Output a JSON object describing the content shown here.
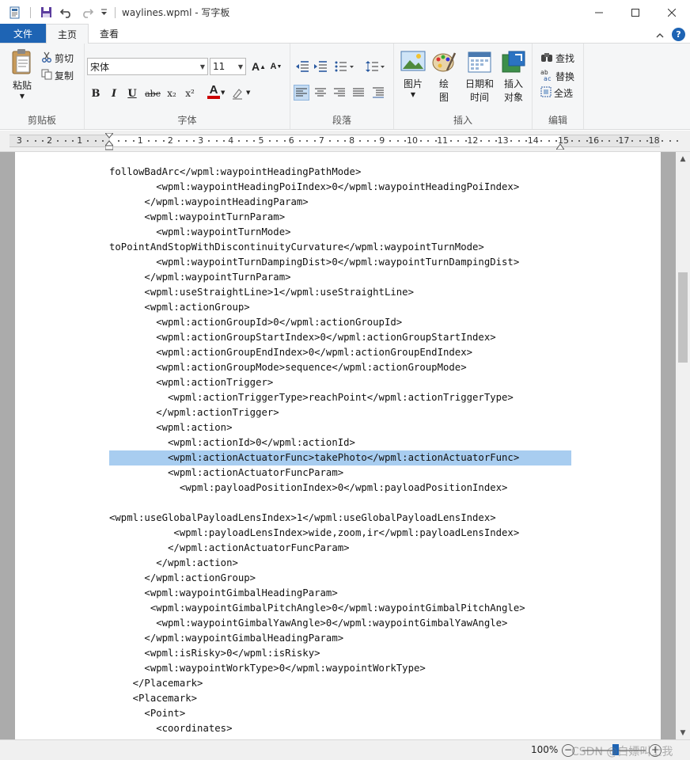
{
  "window": {
    "title": "waylines.wpml - 写字板",
    "title_separator": "|"
  },
  "ribbon_tabs": {
    "file": "文件",
    "home": "主页",
    "view": "查看"
  },
  "clipboard": {
    "paste": "粘贴",
    "cut": "剪切",
    "copy": "复制",
    "group_label": "剪贴板"
  },
  "font": {
    "family": "宋体",
    "size": "11",
    "group_label": "字体",
    "bold": "B",
    "italic": "I",
    "underline": "U",
    "strike": "abc",
    "subscript": "x₂",
    "superscript": "x²",
    "color_letter": "A",
    "font_color": "#cc0000"
  },
  "paragraph": {
    "group_label": "段落"
  },
  "insert": {
    "picture": "图片",
    "paint_line1": "绘",
    "paint_line2": "图",
    "datetime_line1": "日期和",
    "datetime_line2": "时间",
    "object_line1": "插入",
    "object_line2": "对象",
    "group_label": "插入"
  },
  "editing": {
    "find": "查找",
    "replace": "替换",
    "select_all": "全选",
    "group_label": "编辑"
  },
  "ruler": {
    "labels": [
      "3",
      "2",
      "1",
      "1",
      "2",
      "3",
      "4",
      "5",
      "6",
      "7",
      "8",
      "9",
      "10",
      "11",
      "12",
      "13",
      "14",
      "15",
      "16",
      "17",
      "18"
    ]
  },
  "document": {
    "lines": [
      {
        "text": "followBadArc</wpml:waypointHeadingPathMode>",
        "selected": false
      },
      {
        "text": "        <wpml:waypointHeadingPoiIndex>0</wpml:waypointHeadingPoiIndex>",
        "selected": false
      },
      {
        "text": "      </wpml:waypointHeadingParam>",
        "selected": false
      },
      {
        "text": "      <wpml:waypointTurnParam>",
        "selected": false
      },
      {
        "text": "        <wpml:waypointTurnMode>",
        "selected": false
      },
      {
        "text": "toPointAndStopWithDiscontinuityCurvature</wpml:waypointTurnMode>",
        "selected": false
      },
      {
        "text": "        <wpml:waypointTurnDampingDist>0</wpml:waypointTurnDampingDist>",
        "selected": false
      },
      {
        "text": "      </wpml:waypointTurnParam>",
        "selected": false
      },
      {
        "text": "      <wpml:useStraightLine>1</wpml:useStraightLine>",
        "selected": false
      },
      {
        "text": "      <wpml:actionGroup>",
        "selected": false
      },
      {
        "text": "        <wpml:actionGroupId>0</wpml:actionGroupId>",
        "selected": false
      },
      {
        "text": "        <wpml:actionGroupStartIndex>0</wpml:actionGroupStartIndex>",
        "selected": false
      },
      {
        "text": "        <wpml:actionGroupEndIndex>0</wpml:actionGroupEndIndex>",
        "selected": false
      },
      {
        "text": "        <wpml:actionGroupMode>sequence</wpml:actionGroupMode>",
        "selected": false
      },
      {
        "text": "        <wpml:actionTrigger>",
        "selected": false
      },
      {
        "text": "          <wpml:actionTriggerType>reachPoint</wpml:actionTriggerType>",
        "selected": false
      },
      {
        "text": "        </wpml:actionTrigger>",
        "selected": false
      },
      {
        "text": "        <wpml:action>",
        "selected": false
      },
      {
        "text": "          <wpml:actionId>0</wpml:actionId>",
        "selected": false
      },
      {
        "text": "          <wpml:actionActuatorFunc>takePhoto</wpml:actionActuatorFunc>",
        "selected": true
      },
      {
        "text": "          <wpml:actionActuatorFuncParam>",
        "selected": false
      },
      {
        "text": "            <wpml:payloadPositionIndex>0</wpml:payloadPositionIndex>",
        "selected": false
      },
      {
        "text": "",
        "selected": false
      },
      {
        "text": "<wpml:useGlobalPayloadLensIndex>1</wpml:useGlobalPayloadLensIndex>",
        "selected": false
      },
      {
        "text": "           <wpml:payloadLensIndex>wide,zoom,ir</wpml:payloadLensIndex>",
        "selected": false
      },
      {
        "text": "          </wpml:actionActuatorFuncParam>",
        "selected": false
      },
      {
        "text": "        </wpml:action>",
        "selected": false
      },
      {
        "text": "      </wpml:actionGroup>",
        "selected": false
      },
      {
        "text": "      <wpml:waypointGimbalHeadingParam>",
        "selected": false
      },
      {
        "text": "       <wpml:waypointGimbalPitchAngle>0</wpml:waypointGimbalPitchAngle>",
        "selected": false
      },
      {
        "text": "        <wpml:waypointGimbalYawAngle>0</wpml:waypointGimbalYawAngle>",
        "selected": false
      },
      {
        "text": "      </wpml:waypointGimbalHeadingParam>",
        "selected": false
      },
      {
        "text": "      <wpml:isRisky>0</wpml:isRisky>",
        "selected": false
      },
      {
        "text": "      <wpml:waypointWorkType>0</wpml:waypointWorkType>",
        "selected": false
      },
      {
        "text": "    </Placemark>",
        "selected": false
      },
      {
        "text": "    <Placemark>",
        "selected": false
      },
      {
        "text": "      <Point>",
        "selected": false
      },
      {
        "text": "        <coordinates>",
        "selected": false
      }
    ]
  },
  "status": {
    "zoom": "100%",
    "zoom_out": "−",
    "zoom_in": "+",
    "watermark": "CSDN @白嫖叫上我"
  },
  "colors": {
    "accent": "#1e64b4",
    "selection": "#a8cdf0"
  }
}
